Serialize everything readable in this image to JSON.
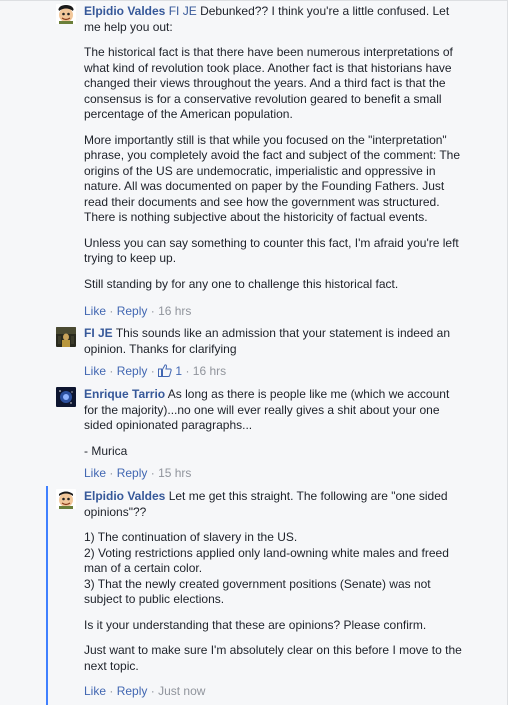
{
  "comments": [
    {
      "author": "Elpidio Valdes",
      "mention": "FI JE",
      "paragraphs": [
        "Debunked?? I think you're a little confused. Let me help you out:",
        "The historical fact is that there have been numerous interpretations of what kind of revolution took place. Another fact is that historians have changed their views throughout the years. And a third fact is that the consensus is for a conservative revolution geared to benefit a small percentage of the American population.",
        "More importantly still is that while you focused on the \"interpretation\" phrase, you completely avoid the fact and subject of the comment: The origins of the US are undemocratic, imperialistic and oppressive in nature. All was documented on paper by the Founding Fathers. Just read their documents and see how the government was structured. There is nothing subjective about the historicity of factual events.",
        "Unless you can say something to counter this fact, I'm afraid you're left trying to keep up.",
        "Still standing by for any one to challenge this historical fact."
      ],
      "like": "Like",
      "reply": "Reply",
      "time": "16 hrs"
    },
    {
      "author": "FI JE",
      "paragraphs": [
        "This sounds like an admission that your statement is indeed an opinion. Thanks for clarifying"
      ],
      "like": "Like",
      "reply": "Reply",
      "likes_count": "1",
      "time": "16 hrs"
    },
    {
      "author": "Enrique Tarrio",
      "paragraphs": [
        "As long as there is people like me (which we account for the majority)...no one will ever really gives a shit about your one sided opinionated paragraphs...",
        "- Murica"
      ],
      "like": "Like",
      "reply": "Reply",
      "time": "15 hrs"
    },
    {
      "author": "Elpidio Valdes",
      "paragraphs": [
        "Let me get this straight. The following are \"one sided opinions\"??",
        "1) The continuation of slavery in the US.",
        "2) Voting restrictions applied only land-owning white males and freed man of a certain color.",
        "3) That the newly created government positions (Senate) was not subject to public elections.",
        "Is it your understanding that these are opinions? Please confirm.",
        "Just want to make sure I'm absolutely clear on this before I move to the next topic."
      ],
      "like": "Like",
      "reply": "Reply",
      "time": "Just now"
    }
  ],
  "separator": "·",
  "colors": {
    "link": "#4267b2",
    "author": "#365899",
    "meta": "#90949c",
    "reply_bar": "#4080ff"
  },
  "icons": [
    "avatar-cartoon-icon",
    "avatar-photo-icon",
    "avatar-space-icon",
    "thumbs-up-icon"
  ]
}
